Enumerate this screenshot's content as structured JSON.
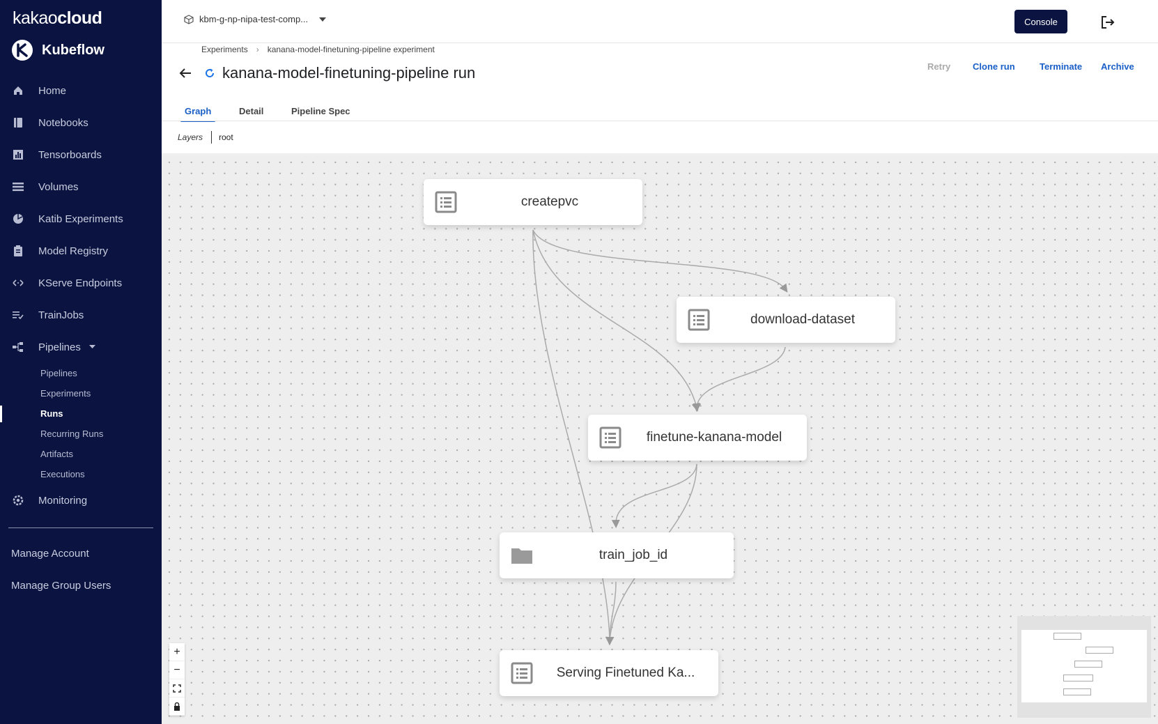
{
  "sidebar": {
    "brand": {
      "left": "kakao",
      "right": "cloud"
    },
    "product": "Kubeflow",
    "items": [
      {
        "label": "Home",
        "icon": "home-icon"
      },
      {
        "label": "Notebooks",
        "icon": "book-icon"
      },
      {
        "label": "Tensorboards",
        "icon": "chart-icon"
      },
      {
        "label": "Volumes",
        "icon": "storage-icon"
      },
      {
        "label": "Katib Experiments",
        "icon": "katib-icon"
      },
      {
        "label": "Model Registry",
        "icon": "clipboard-icon"
      },
      {
        "label": "KServe Endpoints",
        "icon": "arrows-icon"
      },
      {
        "label": "TrainJobs",
        "icon": "checklist-icon"
      },
      {
        "label": "Pipelines",
        "icon": "pipeline-icon"
      }
    ],
    "sub_items": [
      {
        "label": "Pipelines"
      },
      {
        "label": "Experiments"
      },
      {
        "label": "Runs"
      },
      {
        "label": "Recurring Runs"
      },
      {
        "label": "Artifacts"
      },
      {
        "label": "Executions"
      }
    ],
    "monitoring": "Monitoring",
    "manage_account": "Manage Account",
    "manage_group_users": "Manage Group Users"
  },
  "topbar": {
    "namespace": "kbm-g-np-nipa-test-comp...",
    "console_label": "Console"
  },
  "breadcrumb": {
    "root": "Experiments",
    "separator": "›",
    "current": "kanana-model-finetuning-pipeline experiment"
  },
  "run": {
    "title": "kanana-model-finetuning-pipeline run",
    "actions": {
      "retry": "Retry",
      "clone": "Clone run",
      "terminate": "Terminate",
      "archive": "Archive"
    }
  },
  "tabs": [
    "Graph",
    "Detail",
    "Pipeline Spec"
  ],
  "layers": {
    "label": "Layers",
    "value": "root"
  },
  "graph": {
    "nodes": [
      {
        "label": "createpvc",
        "kind": "execution"
      },
      {
        "label": "download-dataset",
        "kind": "execution"
      },
      {
        "label": "finetune-kanana-model",
        "kind": "execution"
      },
      {
        "label": "train_job_id",
        "kind": "artifact"
      },
      {
        "label": "Serving Finetuned Ka...",
        "kind": "execution"
      }
    ]
  },
  "controls": {
    "zoom_in": "+",
    "zoom_out": "−"
  },
  "colors": {
    "sidebar": "#0b1440",
    "accent": "#1a5fc7"
  }
}
